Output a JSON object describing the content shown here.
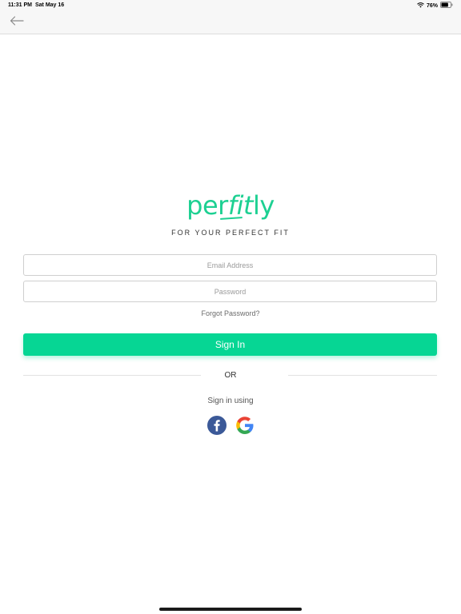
{
  "status_bar": {
    "time": "11:31 PM",
    "date": "Sat May 16",
    "battery_percent": "76%",
    "battery_level": 0.76,
    "icons": [
      "wifi-icon",
      "battery-icon"
    ]
  },
  "nav": {
    "back_icon": "back-arrow-icon"
  },
  "brand": {
    "logo_prefix": "per",
    "logo_fit": "fit",
    "logo_suffix": "ly",
    "tagline": "FOR YOUR PERFECT FIT",
    "accent_color": "#06d694"
  },
  "form": {
    "email_placeholder": "Email Address",
    "email_value": "",
    "password_placeholder": "Password",
    "password_value": "",
    "forgot_label": "Forgot Password?",
    "signin_label": "Sign In"
  },
  "divider": {
    "or_label": "OR"
  },
  "social": {
    "sign_in_using_label": "Sign in using",
    "providers": [
      "facebook-icon",
      "google-icon"
    ]
  }
}
